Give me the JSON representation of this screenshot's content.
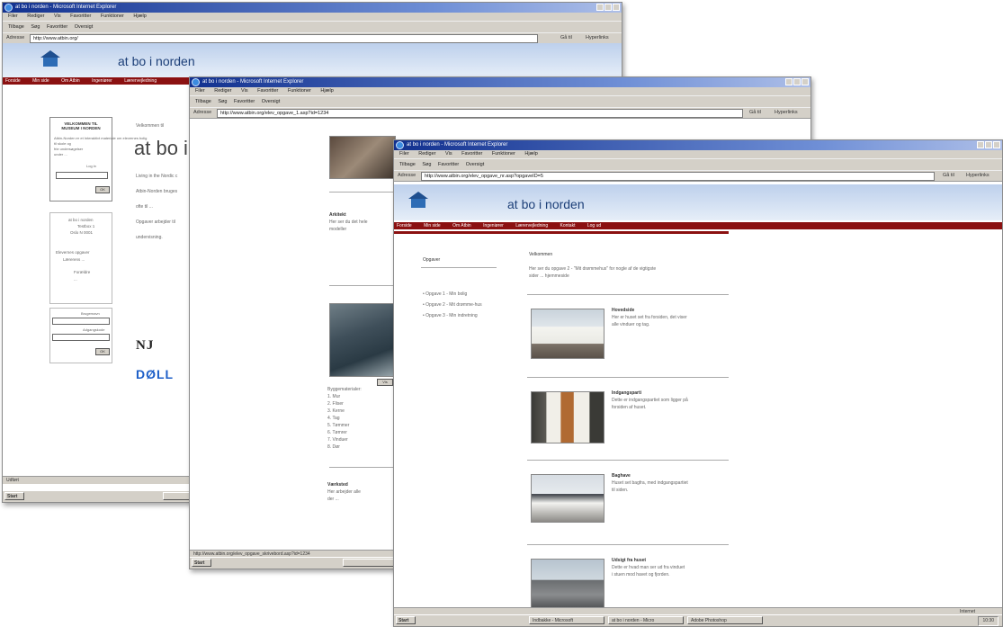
{
  "windows": {
    "back": {
      "title": "at bo i norden - Microsoft Internet Explorer",
      "menu": [
        "Filer",
        "Rediger",
        "Vis",
        "Favoritter",
        "Funktioner",
        "Hjælp"
      ],
      "toolbar": [
        "Tilbage",
        "Søg",
        "Favoritter",
        "Oversigt"
      ],
      "address_label": "Adresse",
      "url": "http://www.atbin.org/",
      "go": "Gå til",
      "links": "Hyperlinks",
      "brand": "at bo i norden",
      "nav": [
        "Forside",
        "Min side",
        "Om Atbin",
        "Ingeniører",
        "Lærervejledning"
      ],
      "side_box_heading": "VELKOMMEN TIL MUSEUM I NORDEN",
      "side_box_text": [
        "Atbin-Norden er et Interaktivt materiale om elevernes bolig",
        "til skole og ",
        "frie undersøgelser",
        "under ..."
      ],
      "login_label": "Log in",
      "address_block": [
        "at bo i norden",
        "Testbox 1",
        "Oslo N 0001"
      ],
      "links_list": [
        "Elevernes opgaver",
        "Lærerens ...",
        "Forældre",
        "..."
      ],
      "username": "Brugernavn",
      "password": "Adgangskode",
      "ok": "OK",
      "welcome": "Velkommen til",
      "big_title": "at bo i",
      "body_lines": [
        "Living in the Nordic c",
        "Atbin-Norden bruges",
        "ofte til ...",
        "Opgaver arbejder til",
        "undervisning."
      ],
      "logo1": "NJ",
      "logo2": "DØLL",
      "status": "Udført",
      "start": "Start"
    },
    "middle": {
      "title": "at bo i norden - Microsoft Internet Explorer",
      "menu": [
        "Filer",
        "Rediger",
        "Vis",
        "Favoritter",
        "Funktioner",
        "Hjælp"
      ],
      "toolbar": [
        "Tilbage",
        "Søg",
        "Favoritter",
        "Oversigt"
      ],
      "address_label": "Adresse",
      "url": "http://www.atbin.org/elev_opgave_1.asp?id=1234",
      "go": "Gå til",
      "links": "Hyperlinks",
      "section1_title": "Arkitekt",
      "section1_text": [
        "Her ser du det hele",
        "modeller"
      ],
      "caption_btn": "Vis",
      "list_title": "Byggematerialer:",
      "list_items": [
        "1. Mur",
        "2. Fliser",
        "3. Kerne",
        "4. Tag",
        "5. Tømmer",
        "6. Tømrer",
        "7. Vinduer",
        "8. Dør"
      ],
      "section2_title": "Værksted",
      "section2_text": [
        "Her arbejder alle",
        "der ..."
      ],
      "status": "http://www.atbin.org/elev_opgave_skrivebord.asp?id=1234",
      "start": "Start"
    },
    "front": {
      "title": "at bo i norden - Microsoft Internet Explorer",
      "menu": [
        "Filer",
        "Rediger",
        "Vis",
        "Favoritter",
        "Funktioner",
        "Hjælp"
      ],
      "toolbar": [
        "Tilbage",
        "Søg",
        "Favoritter",
        "Oversigt"
      ],
      "address_label": "Adresse",
      "url": "http://www.atbin.org/elev_opgave_nr.asp?opgaveID=5",
      "go": "Gå til",
      "links": "Hyperlinks",
      "brand": "at bo i norden",
      "nav": [
        "Forside",
        "Min side",
        "Om Atbin",
        "Ingeniører",
        "Lærervejledning",
        "Kontakt",
        "Log ud"
      ],
      "side_title": "Opgaver",
      "side_items": [
        "Opgave 1 - Min bolig",
        "Opgave 2 - Mit drømme-hus",
        "Opgave 3 - Min indretning"
      ],
      "intro_title": "Velkommen",
      "intro_text": [
        "Her ser du opgave 2 - \"Mit drømmehus\" for nogle af de vigtigste",
        "sider ... hjemmeside"
      ],
      "items": [
        {
          "title": "Hovedside",
          "text": [
            "Her er huset set fra forsiden, det viser",
            "alle vinduer og tag."
          ]
        },
        {
          "title": "Indgangsparti",
          "text": [
            "Dette er indgangspartiet som ligger på",
            "forsiden af huset."
          ]
        },
        {
          "title": "Baghave",
          "text": [
            "Huset set bagfra, med indgangspartiet",
            "til siden."
          ]
        },
        {
          "title": "Udsigt fra huset",
          "text": [
            "Dette er hvad man ser ud fra vinduet",
            "i stuen mod havet og fjorden."
          ]
        }
      ],
      "status": "Internet",
      "start": "Start",
      "task_buttons": [
        "Indbakke - Microsoft",
        "at bo i norden - Micro",
        "Adobe Photoshop"
      ],
      "clock": "10:30"
    }
  },
  "colors": {
    "nav_red": "#8b1111",
    "title_blue": "#12318f",
    "brand_blue": "#1c3f78"
  }
}
